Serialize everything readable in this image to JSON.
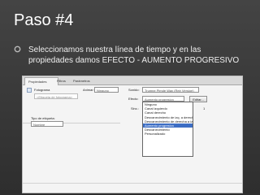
{
  "slide": {
    "title": "Paso #4",
    "bullet_icon": "circle-bullet-icon",
    "bullet_text": "Seleccionamos nuestra línea de tiempo y en las propiedades damos EFECTO - AUMENTO PROGRESIVO"
  },
  "screenshot": {
    "tabs": [
      {
        "label": "Propiedades"
      },
      {
        "label": "Filtros"
      },
      {
        "label": "Parámetros"
      }
    ],
    "fotograma_label": "Fotograma",
    "fotograma_placeholder": "<Etiqueta de fotograma>",
    "animar_label": "Animar:",
    "animar_value": "Ninguno",
    "sonido_label": "Sonido:",
    "sonido_value": "Trumne Pimde Way (Reir Version)",
    "efecto_label": "Efecto:",
    "efecto_value": "Aumento progresivo",
    "editar_label": "Editar...",
    "sinc_label": "Sinc.:",
    "sinc_count": "1",
    "tipo_etiqueta_label": "Tipo de etiqueta:",
    "tipo_etiqueta_value": "Nombre",
    "effect_options": [
      "Ninguno",
      "Canal izquierdo",
      "Canal derecho",
      "Desvanecimiento de izq. a derecha",
      "Desvanecimiento de derecha a izq.",
      "Aumento progresivo",
      "Desvanecimiento",
      "Personalizado"
    ],
    "selected_option_index": 5
  }
}
